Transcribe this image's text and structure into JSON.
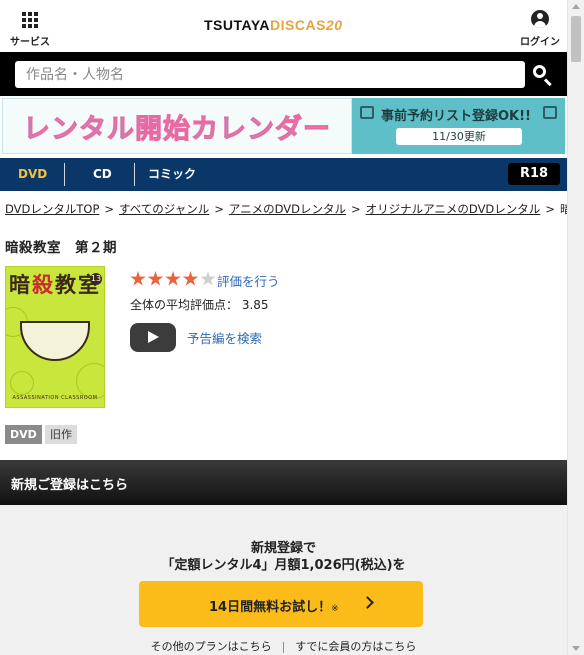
{
  "header": {
    "services_label": "サービス",
    "logo_part1": "TSUTAYA",
    "logo_part2": "DISCAS",
    "logo_part3": "20",
    "login_label": "ログイン"
  },
  "search": {
    "placeholder": "作品名・人物名"
  },
  "banner": {
    "left_text": "レンタル開始カレンダー",
    "right_text": "事前予約リスト登録OK!!",
    "right_date": "11/30更新"
  },
  "category_nav": {
    "tabs": [
      "DVD",
      "CD",
      "コミック"
    ],
    "r18": "R18",
    "active_color": "#f2c23b",
    "bg_color": "#0a3768"
  },
  "breadcrumb": {
    "items": [
      "DVDレンタルTOP",
      "すべてのジャンル",
      "アニメのDVDレンタル",
      "オリジナルアニメのDVDレンタル",
      "暗殺"
    ],
    "separator": ">"
  },
  "product": {
    "title": "暗殺教室　第２期",
    "cover_title_1": "暗",
    "cover_title_2": "殺",
    "cover_title_3": "教室",
    "cover_volume": "13",
    "cover_subtitle": "ASSASSINATION CLASSROOM",
    "rating_stars": 4,
    "rating_max": 5,
    "rate_link": "評価を行う",
    "avg_label": "全体の平均評価点：",
    "avg_value": "3.85",
    "trailer_link": "予告編を検索",
    "badge_format": "DVD",
    "badge_status": "旧作"
  },
  "registration": {
    "bar_title": "新規ご登録はこちら",
    "line1": "新規登録で",
    "line2": "「定額レンタル4」月額1,026円(税込)を",
    "cta_label": "14日間無料お試し！",
    "cta_note": "※",
    "cta_color": "#fbbc1a",
    "link_other_plans": "その他のプランはこちら",
    "link_member": "すでに会員の方はこちら"
  }
}
